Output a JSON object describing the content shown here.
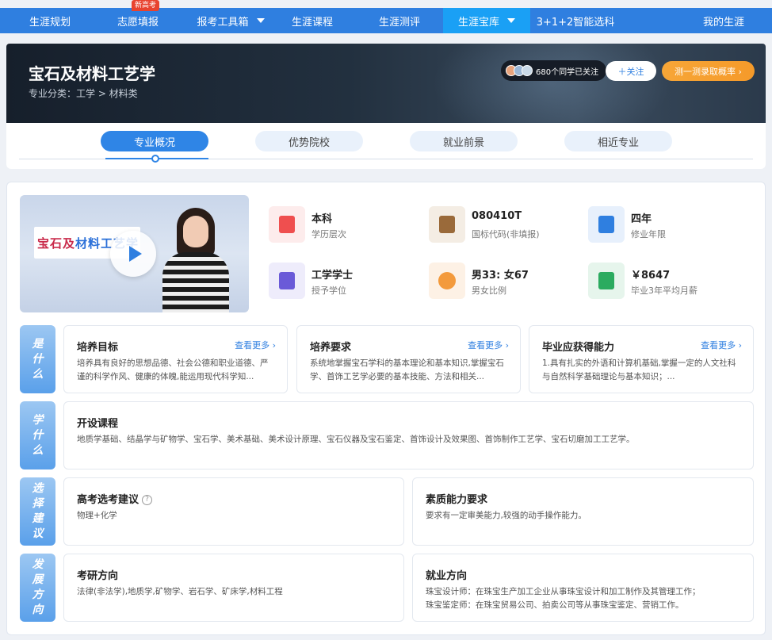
{
  "nav": {
    "items": [
      {
        "label": "生涯规划"
      },
      {
        "label": "志愿填报",
        "badge": "新高考"
      },
      {
        "label": "报考工具箱"
      },
      {
        "label": "生涯课程"
      },
      {
        "label": "生涯测评"
      },
      {
        "label": "生涯宝库"
      },
      {
        "label": "3+1+2智能选科"
      },
      {
        "label": "我的生涯"
      }
    ]
  },
  "hero": {
    "title": "宝石及材料工艺学",
    "category": "专业分类：工学 > 材料类",
    "follow_count": "680个同学已关注",
    "follow_btn": "＋关注",
    "test_btn": "测一测录取概率 ›"
  },
  "tabs": [
    {
      "label": "专业概况"
    },
    {
      "label": "优势院校"
    },
    {
      "label": "就业前景"
    },
    {
      "label": "相近专业"
    }
  ],
  "video": {
    "title_a": "宝石及",
    "title_b": "材料工艺学"
  },
  "info": [
    {
      "value": "本科",
      "label": "学历层次",
      "icon": "checklist-icon",
      "color": "#ef4f4f",
      "bg": "#fdecec"
    },
    {
      "value": "080410T",
      "label": "国标代码(非填报)",
      "icon": "document-icon",
      "color": "#9a6a3a",
      "bg": "#f4ede4"
    },
    {
      "value": "四年",
      "label": "修业年限",
      "icon": "bank-icon",
      "color": "#2f7fe0",
      "bg": "#e7f0fc"
    },
    {
      "value": "工学学士",
      "label": "授予学位",
      "icon": "certificate-icon",
      "color": "#6a5ad8",
      "bg": "#eeecfb"
    },
    {
      "value": "男33: 女67",
      "label": "男女比例",
      "icon": "pie-chart-icon",
      "color": "#f39a3c",
      "bg": "#fdf1e5"
    },
    {
      "value": "￥8647",
      "label": "毕业3年平均月薪",
      "icon": "money-icon",
      "color": "#2bab5f",
      "bg": "#e6f5ec"
    }
  ],
  "sections": {
    "what": {
      "side": [
        "是",
        "什",
        "么"
      ],
      "cards": [
        {
          "title": "培养目标",
          "more": "查看更多 ›",
          "body": "培养具有良好的思想品德、社会公德和职业道德、严谨的科学作风、健康的体魄,能运用现代科学知..."
        },
        {
          "title": "培养要求",
          "more": "查看更多 ›",
          "body": "系统地掌握宝石学科的基本理论和基本知识,掌握宝石学、首饰工艺学必要的基本技能、方法和相关..."
        },
        {
          "title": "毕业应获得能力",
          "more": "查看更多 ›",
          "body": "1.具有扎实的外语和计算机基础,掌握一定的人文社科与自然科学基础理论与基本知识；..."
        }
      ]
    },
    "learn": {
      "side": [
        "学",
        "什",
        "么"
      ],
      "title": "开设课程",
      "body": "地质学基础、结晶学与矿物学、宝石学、美术基础、美术设计原理、宝石仪器及宝石鉴定、首饰设计及效果图、首饰制作工艺学、宝石切磨加工工艺学。"
    },
    "advice": {
      "side": [
        "选",
        "择",
        "建",
        "议"
      ],
      "cards": [
        {
          "title": "高考选考建议",
          "body": "物理+化学"
        },
        {
          "title": "素质能力要求",
          "body": "要求有一定审美能力,较强的动手操作能力。"
        }
      ]
    },
    "future": {
      "side": [
        "发",
        "展",
        "方",
        "向"
      ],
      "cards": [
        {
          "title": "考研方向",
          "body": "法律(非法学),地质学,矿物学、岩石学、矿床学,材料工程"
        },
        {
          "title": "就业方向",
          "lines": [
            "珠宝设计师：在珠宝生产加工企业从事珠宝设计和加工制作及其管理工作；",
            "珠宝鉴定师：在珠宝贸易公司、拍卖公司等从事珠宝鉴定、营销工作。"
          ]
        }
      ]
    }
  }
}
